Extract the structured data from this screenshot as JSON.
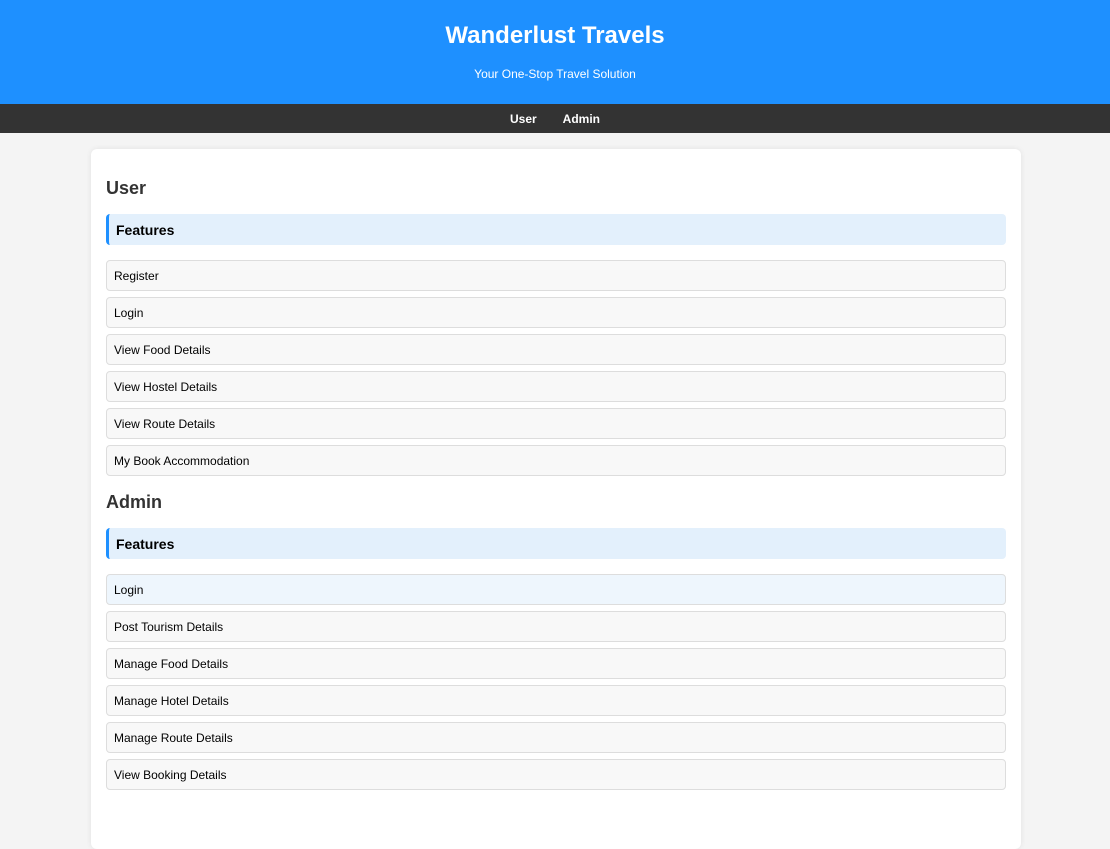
{
  "header": {
    "title": "Wanderlust Travels",
    "tagline": "Your One-Stop Travel Solution"
  },
  "nav": {
    "items": [
      {
        "label": "User"
      },
      {
        "label": "Admin"
      }
    ]
  },
  "colors": {
    "brand": "#1e90ff",
    "nav_background": "#333333",
    "features_background": "#e3f0fc",
    "page_background": "#f4f4f4"
  },
  "user_section": {
    "heading": "User",
    "features_title": "Features",
    "items": [
      {
        "label": "Register"
      },
      {
        "label": "Login"
      },
      {
        "label": "View Food Details"
      },
      {
        "label": "View Hostel Details"
      },
      {
        "label": "View Route Details"
      },
      {
        "label": "My Book Accommodation"
      }
    ]
  },
  "admin_section": {
    "heading": "Admin",
    "features_title": "Features",
    "items": [
      {
        "label": "Login"
      },
      {
        "label": "Post Tourism Details"
      },
      {
        "label": "Manage Food Details"
      },
      {
        "label": "Manage Hotel Details"
      },
      {
        "label": "Manage Route Details"
      },
      {
        "label": "View Booking Details"
      }
    ]
  }
}
